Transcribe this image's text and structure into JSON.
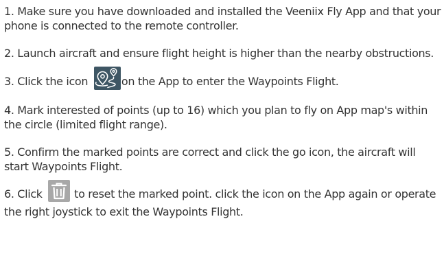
{
  "instructions": {
    "step1": "1. Make sure you have downloaded and installed the Veeniix Fly App and that your phone is connected to the remote controller.",
    "step2": "2. Launch aircraft and ensure flight height is higher than the nearby obstructions.",
    "step3": {
      "before": "3. Click the icon",
      "after": "on the App to enter the Waypoints Flight.",
      "icon": "waypoints-icon"
    },
    "step4": "4. Mark interested of points (up to 16) which you plan to fly on App map's within the circle (limited flight range).",
    "step5": "5. Confirm the marked points are correct and click the go icon, the aircraft will start Waypoints Flight.",
    "step6": {
      "before": "6. Click",
      "after": "to reset the marked point. click the icon on the App again or operate the right joystick to exit the Waypoints Flight.",
      "icon": "trash-icon"
    }
  },
  "colors": {
    "text": "#333333",
    "waypoints_icon_bg": "#3e5664",
    "waypoints_icon_fg": "#ffffff",
    "trash_icon_bg": "#a8a8a8",
    "trash_icon_fg": "#ffffff"
  }
}
